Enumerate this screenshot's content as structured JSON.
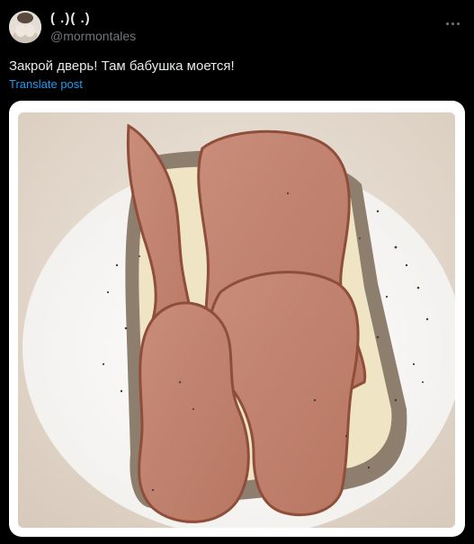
{
  "post": {
    "author": {
      "display_name": "( .)( .)",
      "handle": "@mormontales"
    },
    "text": "Закрой дверь! Там бабушка моется!",
    "translate_label": "Translate post",
    "more_icon": "more-horizontal-icon",
    "media": {
      "type": "photo"
    }
  },
  "colors": {
    "background": "#000000",
    "text_primary": "#e7e9ea",
    "text_secondary": "#71767b",
    "link": "#1d9bf0"
  }
}
